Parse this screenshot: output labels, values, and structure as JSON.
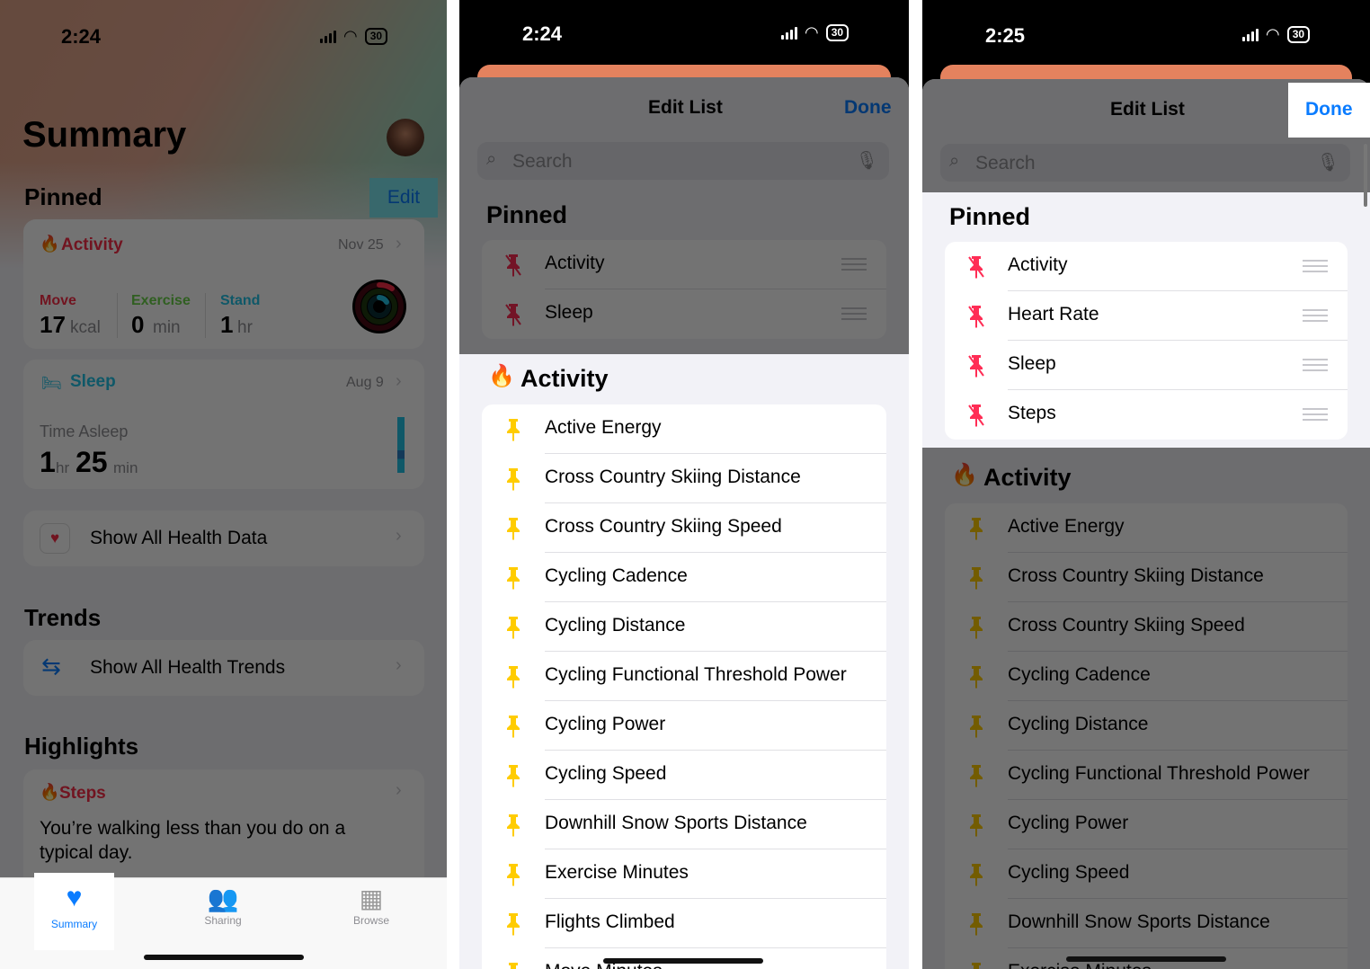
{
  "colors": {
    "accent": "#0a7cff",
    "activity": "#fa2d48",
    "exercise": "#6bd34a",
    "stand": "#22c3e6",
    "pin_yellow": "#ffcc00",
    "pin_red": "#ff2d55",
    "highlight": "#7de7f0"
  },
  "screen1": {
    "status": {
      "time": "2:24",
      "battery": "30"
    },
    "title": "Summary",
    "pinned_header": "Pinned",
    "edit_button": "Edit",
    "activity": {
      "label": "Activity",
      "date": "Nov 25",
      "move_label": "Move",
      "move_value": "17",
      "move_unit": "kcal",
      "exercise_label": "Exercise",
      "exercise_value": "0",
      "exercise_unit": "min",
      "stand_label": "Stand",
      "stand_value": "1",
      "stand_unit": "hr"
    },
    "sleep": {
      "label": "Sleep",
      "date": "Aug 9",
      "metric_label": "Time Asleep",
      "hours": "1",
      "hours_unit": "hr",
      "minutes": "25",
      "minutes_unit": "min"
    },
    "show_all_health_data": "Show All Health Data",
    "trends_header": "Trends",
    "show_all_health_trends": "Show All Health Trends",
    "highlights_header": "Highlights",
    "steps_highlight": {
      "label": "Steps",
      "text_line1": "You’re walking less than you do on a",
      "text_line2": "typical day."
    },
    "tabs": [
      {
        "label": "Summary",
        "icon": "heart-icon"
      },
      {
        "label": "Sharing",
        "icon": "people-icon"
      },
      {
        "label": "Browse",
        "icon": "grid-icon"
      }
    ]
  },
  "screen2": {
    "status": {
      "time": "2:24",
      "battery": "30"
    },
    "sheet_title": "Edit List",
    "done": "Done",
    "search_placeholder": "Search",
    "pinned_header": "Pinned",
    "pinned": [
      "Activity",
      "Sleep"
    ],
    "activity_header": "Activity",
    "activity_items": [
      "Active Energy",
      "Cross Country Skiing Distance",
      "Cross Country Skiing Speed",
      "Cycling Cadence",
      "Cycling Distance",
      "Cycling Functional Threshold Power",
      "Cycling Power",
      "Cycling Speed",
      "Downhill Snow Sports Distance",
      "Exercise Minutes",
      "Flights Climbed",
      "Move Minutes"
    ]
  },
  "screen3": {
    "status": {
      "time": "2:25",
      "battery": "30"
    },
    "sheet_title": "Edit List",
    "done": "Done",
    "search_placeholder": "Search",
    "pinned_header": "Pinned",
    "pinned": [
      "Activity",
      "Heart Rate",
      "Sleep",
      "Steps"
    ],
    "activity_header": "Activity",
    "activity_items": [
      "Active Energy",
      "Cross Country Skiing Distance",
      "Cross Country Skiing Speed",
      "Cycling Cadence",
      "Cycling Distance",
      "Cycling Functional Threshold Power",
      "Cycling Power",
      "Cycling Speed",
      "Downhill Snow Sports Distance",
      "Exercise Minutes"
    ]
  }
}
